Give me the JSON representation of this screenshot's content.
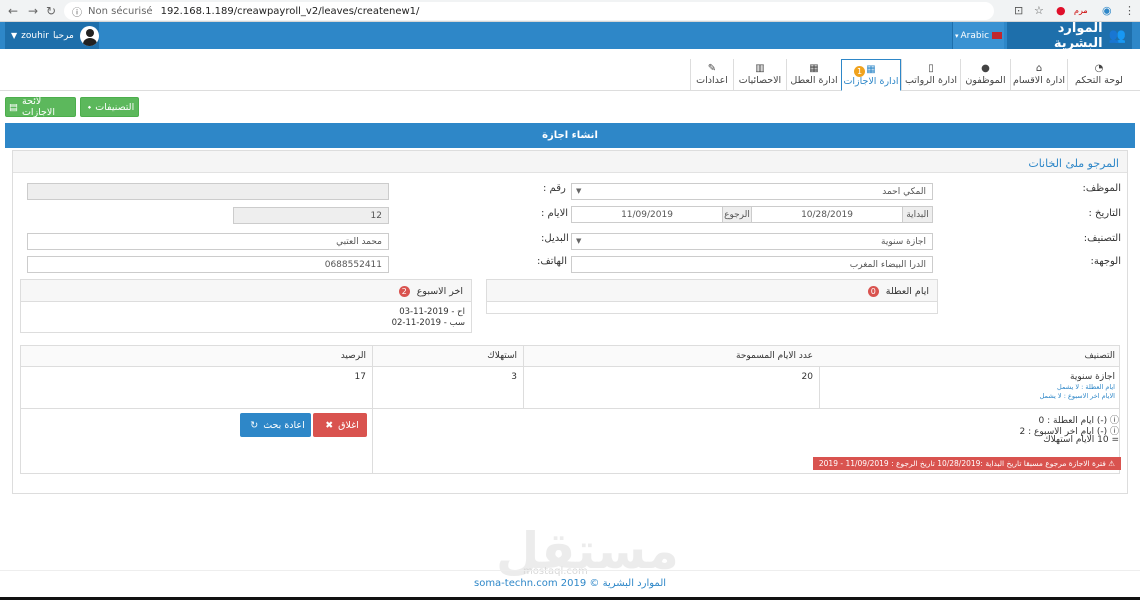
{
  "browser": {
    "security": "Non sécurisé",
    "url": "192.168.1.189/creawpayroll_v2/leaves/createnew1/",
    "ext_label": "مرم"
  },
  "topbar": {
    "brand": "الموارد البشرية",
    "language": "Arabic",
    "user_name": "zouhir",
    "greeting": "مرحبا"
  },
  "tabs": [
    {
      "label": "لوحة التحكم",
      "icon": "dashboard-icon"
    },
    {
      "label": "ادارة الاقسام",
      "icon": "home-icon"
    },
    {
      "label": "الموظفون",
      "icon": "user-icon"
    },
    {
      "label": "ادارة الرواتب",
      "icon": "document-icon"
    },
    {
      "label": "ادارة الاجازات",
      "icon": "calendar-icon",
      "badge": "1"
    },
    {
      "label": "ادارة العطل",
      "icon": "calendar-icon"
    },
    {
      "label": "الاحصائيات",
      "icon": "bar-chart-icon"
    },
    {
      "label": "اعدادات",
      "icon": "wrench-icon"
    }
  ],
  "actions": {
    "leaves_list": "لائحة الاجازات",
    "categories": "التصنيفات"
  },
  "banner": "انشاء اجازة",
  "form": {
    "header": "المرجو ملئ الخانات",
    "employee_label": "الموظف:",
    "employee_value": "المكي احمد",
    "number_label": "رقم :",
    "date_label": "التاريخ :",
    "start_addon": "البداية",
    "start_value": "10/28/2019",
    "return_addon": "الرجوع",
    "return_value": "11/09/2019",
    "days_label": "الايام :",
    "days_value": "12",
    "category_label": "التصنيف:",
    "category_value": "اجازة سنوية",
    "substitute_label": "البديل:",
    "substitute_value": "محمد العتبي",
    "destination_label": "الوجهة:",
    "destination_value": "الدرا البيضاء المغرب",
    "phone_label": "الهاتف:",
    "phone_value": "0688552411"
  },
  "holidays_box": {
    "title": "ايام العطلة",
    "count": "0"
  },
  "weekend_box": {
    "title": "اخر الاسبوع",
    "count": "2",
    "lines": [
      "اح - 2019-11-03",
      "سب - 2019-11-02"
    ]
  },
  "table": {
    "headers": [
      "التصنيف",
      "عدد الايام المسموحة",
      "استهلاك",
      "الرصيد"
    ],
    "row": {
      "category": "اجازة سنوية",
      "note1": "ايام العطلة : لا يشمل",
      "note2": "الايام اخر الاسبوع : لا يشمل",
      "allowed": "20",
      "used": "3",
      "balance": "17"
    }
  },
  "summary": {
    "holidays": "(-) ايام العطلة : 0",
    "weekends": "(-) ايام اخر الاسبوع : 2",
    "total": "= 10 الايام استهلاك"
  },
  "warning": "فترة الاجازة مرجوع مسبقا تاريخ البداية :10/28/2019 تاريخ الرجوع : 11/09/2019 - 2019",
  "buttons": {
    "close": "اغلاق",
    "reset": "اعادة بحث"
  },
  "watermark": {
    "main": "مستقل",
    "sub": "mostaql.com"
  },
  "footer": "الموارد البشرية © 2019 soma-techn.com",
  "colors": {
    "primary": "#2e87c8",
    "success": "#5cb85c",
    "danger": "#d9534f",
    "warning_badge": "#f0a21d"
  }
}
